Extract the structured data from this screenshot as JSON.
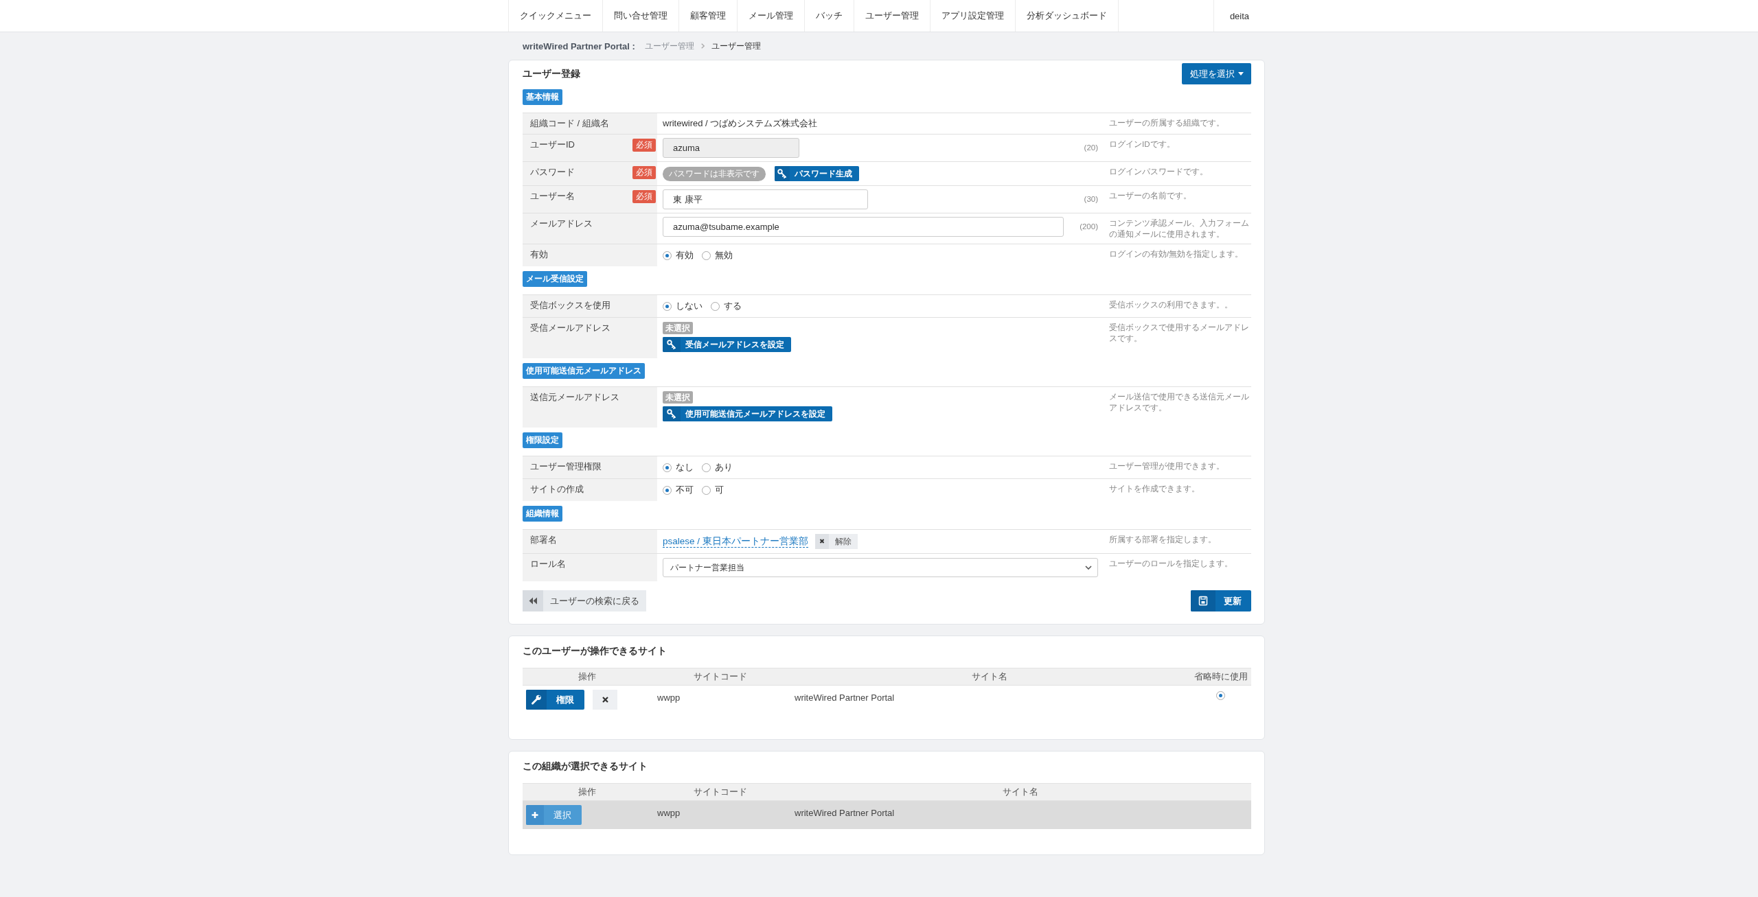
{
  "nav": {
    "items": [
      {
        "label": "クイックメニュー"
      },
      {
        "label": "問い合せ管理"
      },
      {
        "label": "顧客管理"
      },
      {
        "label": "メール管理"
      },
      {
        "label": "バッチ"
      },
      {
        "label": "ユーザー管理"
      },
      {
        "label": "アプリ設定管理"
      },
      {
        "label": "分析ダッシュボード"
      }
    ],
    "user": "deita"
  },
  "breadcrumb": {
    "site": "writeWired Partner Portal :",
    "items": [
      {
        "label": "ユーザー管理",
        "current": false
      },
      {
        "label": "ユーザー管理",
        "current": true
      }
    ]
  },
  "user_form": {
    "title": "ユーザー登録",
    "action_button": "処理を選択",
    "sections": [
      {
        "label": "基本情報",
        "rows": [
          {
            "kind": "text",
            "label": "組織コード / 組織名",
            "value": "writewired / つばめシステムズ株式会社",
            "description": "ユーザーの所属する組織です。"
          },
          {
            "kind": "input",
            "label": "ユーザーID",
            "badge": "必須",
            "value": "azuma",
            "disabled": true,
            "limit": "(20)",
            "description": "ログインIDです。"
          },
          {
            "kind": "password",
            "label": "パスワード",
            "badge": "必須",
            "status": "パスワードは非表示です",
            "button": "パスワード生成",
            "description": "ログインパスワードです。"
          },
          {
            "kind": "input",
            "label": "ユーザー名",
            "badge": "必須",
            "value": "東 康平",
            "disabled": false,
            "limit": "(30)",
            "description": "ユーザーの名前です。"
          },
          {
            "kind": "input",
            "label": "メールアドレス",
            "value": "azuma@tsubame.example",
            "disabled": false,
            "limit": "(200)",
            "description": "コンテンツ承認メール、入力フォームの通知メールに使用されます。"
          },
          {
            "kind": "radio",
            "label": "有効",
            "options": [
              {
                "label": "有効",
                "selected": true
              },
              {
                "label": "無効",
                "selected": false
              }
            ],
            "description": "ログインの有効/無効を指定します。"
          }
        ]
      },
      {
        "label": "メール受信設定",
        "rows": [
          {
            "kind": "radio",
            "label": "受信ボックスを使用",
            "options": [
              {
                "label": "しない",
                "selected": true
              },
              {
                "label": "する",
                "selected": false
              }
            ],
            "description": "受信ボックスの利用できます。。"
          },
          {
            "kind": "picker",
            "label": "受信メールアドレス",
            "status": "未選択",
            "button": "受信メールアドレスを設定",
            "description": "受信ボックスで使用するメールアドレスです。"
          }
        ]
      },
      {
        "label": "使用可能送信元メールアドレス",
        "rows": [
          {
            "kind": "picker",
            "label": "送信元メールアドレス",
            "status": "未選択",
            "button": "使用可能送信元メールアドレスを設定",
            "description": "メール送信で使用できる送信元メールアドレスです。"
          }
        ]
      },
      {
        "label": "権限設定",
        "rows": [
          {
            "kind": "radio",
            "label": "ユーザー管理権限",
            "options": [
              {
                "label": "なし",
                "selected": true
              },
              {
                "label": "あり",
                "selected": false
              }
            ],
            "description": "ユーザー管理が使用できます。"
          },
          {
            "kind": "radio",
            "label": "サイトの作成",
            "options": [
              {
                "label": "不可",
                "selected": true
              },
              {
                "label": "可",
                "selected": false
              }
            ],
            "description": "サイトを作成できます。"
          }
        ]
      },
      {
        "label": "組織情報",
        "rows": [
          {
            "kind": "department",
            "label": "部署名",
            "value": "psalese / 東日本パートナー営業部",
            "button": "解除",
            "description": "所属する部署を指定します。"
          },
          {
            "kind": "select",
            "label": "ロール名",
            "value": "パートナー営業担当",
            "description": "ユーザーのロールを指定します。"
          }
        ]
      }
    ],
    "back_button": "ユーザーの検索に戻る",
    "update_button": "更新"
  },
  "user_sites": {
    "title": "このユーザーが操作できるサイト",
    "columns": [
      "操作",
      "サイトコード",
      "サイト名",
      "省略時に使用"
    ],
    "rows": [
      {
        "kind": "edit",
        "action": "権限",
        "site_code": "wwpp",
        "site_name": "writeWired Partner Portal",
        "selected": true
      }
    ]
  },
  "org_sites": {
    "title": "この組織が選択できるサイト",
    "columns": [
      "操作",
      "サイトコード",
      "サイト名"
    ],
    "rows": [
      {
        "kind": "add",
        "action": "選択",
        "site_code": "wwpp",
        "site_name": "writeWired Partner Portal",
        "disabled": true
      }
    ]
  }
}
